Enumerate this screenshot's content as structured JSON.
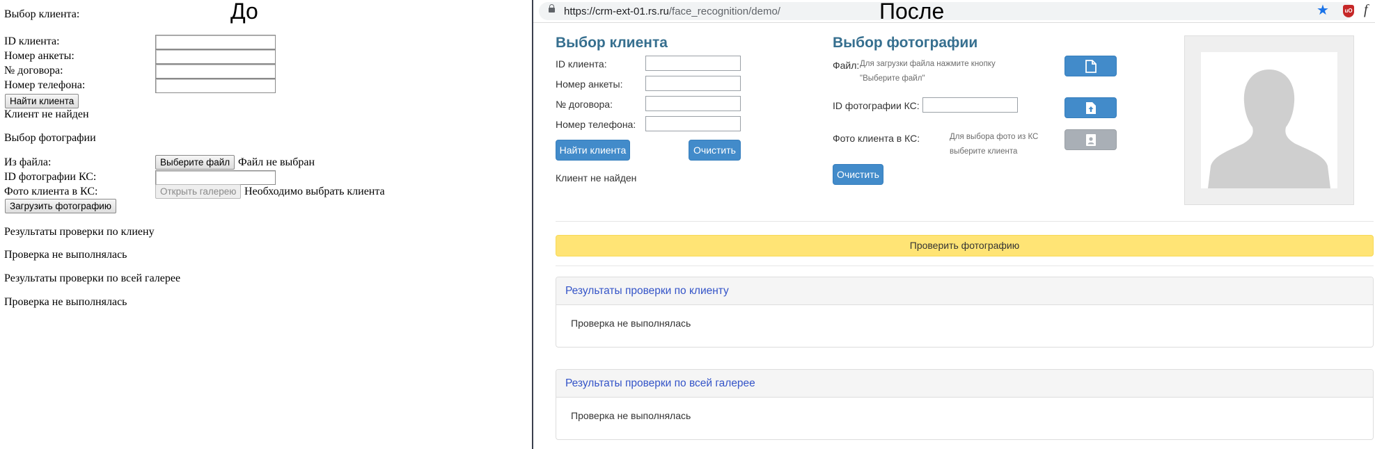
{
  "before": {
    "caption": "До",
    "client_section_title": "Выбор клиента:",
    "fields": [
      {
        "label": "ID клиента:",
        "value": ""
      },
      {
        "label": "Номер анкеты:",
        "value": ""
      },
      {
        "label": "№ договора:",
        "value": ""
      },
      {
        "label": "Номер телефона:",
        "value": ""
      }
    ],
    "find_button": "Найти клиента",
    "client_status": "Клиент не найден",
    "photo_section_title": "Выбор фотографии",
    "from_file_label": "Из файла:",
    "choose_file_button": "Выберите файл",
    "no_file_text": "Файл не выбран",
    "photo_id_label": "ID фотографии КС:",
    "photo_id_value": "",
    "client_photo_label": "Фото клиента в КС:",
    "open_gallery_button": "Открыть галерею",
    "need_client_text": "Необходимо выбрать клиента",
    "upload_button": "Загрузить фотографию",
    "client_results_title": "Результаты проверки по клиену",
    "client_results_status": "Проверка не выполнялась",
    "gallery_results_title": "Результаты проверки по всей галерее",
    "gallery_results_status": "Проверка не выполнялась"
  },
  "after": {
    "caption": "После",
    "browser": {
      "url_host": "https://crm-ext-01.rs.ru",
      "url_path": "/face_recognition/demo/",
      "icons": [
        "lock-icon",
        "star-icon",
        "ublock-icon",
        "extension-f-icon"
      ]
    },
    "client": {
      "title": "Выбор клиента",
      "fields": [
        {
          "label": "ID клиента:",
          "value": ""
        },
        {
          "label": "Номер анкеты:",
          "value": ""
        },
        {
          "label": "№ договора:",
          "value": ""
        },
        {
          "label": "Номер телефона:",
          "value": ""
        }
      ],
      "find_button": "Найти клиента",
      "clear_button": "Очистить",
      "status": "Клиент не найден"
    },
    "photo": {
      "title": "Выбор фотографии",
      "file_label": "Файл:",
      "file_hint": "Для загрузки файла нажмите кнопку \"Выберите файл\"",
      "id_label": "ID фотографии КС:",
      "id_value": "",
      "client_photo_label": "Фото клиента в КС:",
      "client_photo_hint": "Для выбора фото из КС выберите клиента",
      "clear_button": "Очистить",
      "icons": [
        "file-icon",
        "upload-icon",
        "contact-photo-icon",
        "avatar-placeholder-icon"
      ]
    },
    "verify_button": "Проверить фотографию",
    "results": [
      {
        "title": "Результаты проверки по клиенту",
        "status": "Проверка не выполнялась"
      },
      {
        "title": "Результаты проверки по всей галерее",
        "status": "Проверка не выполнялась"
      }
    ],
    "colors": {
      "heading": "#366f8f",
      "primary_button": "#428bca",
      "disabled_button": "#a9afb6",
      "verify_button": "#ffe475",
      "panel_title": "#3454c8"
    }
  }
}
